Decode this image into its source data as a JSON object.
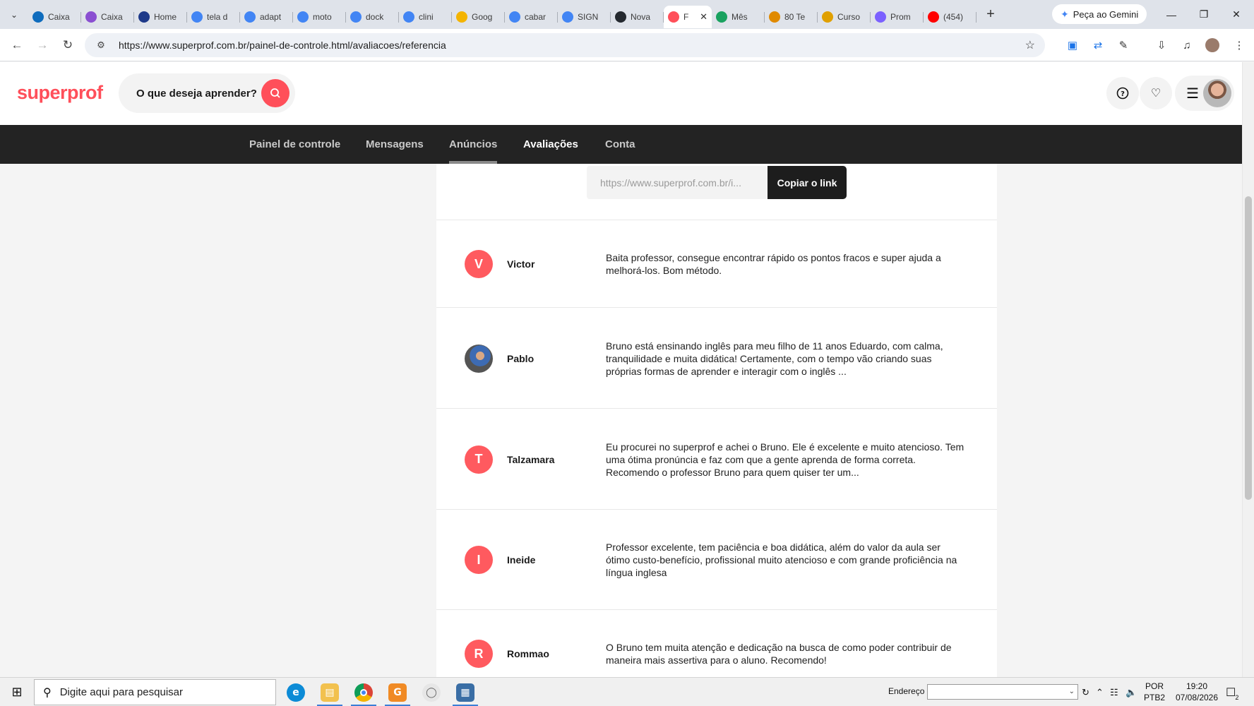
{
  "browser": {
    "tabs": [
      {
        "title": "Caixa",
        "icon": "outlook-icon",
        "color": "#0f6cbd"
      },
      {
        "title": "Caixa",
        "icon": "mail-icon",
        "color": "#8a4fd1"
      },
      {
        "title": "Home",
        "icon": "wordpress-icon",
        "color": "#1e3a8a"
      },
      {
        "title": "tela d",
        "icon": "google-icon",
        "color": "#4285f4"
      },
      {
        "title": "adapt",
        "icon": "google-icon",
        "color": "#4285f4"
      },
      {
        "title": "moto",
        "icon": "google-icon",
        "color": "#4285f4"
      },
      {
        "title": "dock",
        "icon": "google-icon",
        "color": "#4285f4"
      },
      {
        "title": "clini",
        "icon": "google-icon",
        "color": "#4285f4"
      },
      {
        "title": "Goog",
        "icon": "drive-folder-icon",
        "color": "#f4b400"
      },
      {
        "title": "cabar",
        "icon": "google-icon",
        "color": "#4285f4"
      },
      {
        "title": "SIGN",
        "icon": "google-icon",
        "color": "#4285f4"
      },
      {
        "title": "Nova",
        "icon": "github-icon",
        "color": "#24292f"
      },
      {
        "title": "F",
        "icon": "superprof-icon",
        "color": "#ff4f5a",
        "active": true
      },
      {
        "title": "Mês",
        "icon": "k-icon",
        "color": "#1aa260"
      },
      {
        "title": "80 Te",
        "icon": "brain-icon",
        "color": "#e08a00"
      },
      {
        "title": "Curso",
        "icon": "brain-icon",
        "color": "#e0a000"
      },
      {
        "title": "Prom",
        "icon": "purple-app-icon",
        "color": "#7b61ff"
      },
      {
        "title": "(454)",
        "icon": "youtube-icon",
        "color": "#ff0000"
      }
    ],
    "gemini_label": "Peça ao Gemini",
    "url": "https://www.superprof.com.br/painel-de-controle.html/avaliacoes/referencia"
  },
  "site": {
    "logo": "superprof",
    "search_placeholder": "O que deseja aprender?",
    "nav": [
      {
        "label": "Painel de controle",
        "bold": false
      },
      {
        "label": "Mensagens",
        "bold": false
      },
      {
        "label": "Anúncios",
        "bold": false,
        "underlined": true
      },
      {
        "label": "Avaliações",
        "bold": true
      },
      {
        "label": "Conta",
        "bold": false
      }
    ],
    "share_link": "https://www.superprof.com.br/i...",
    "copy_button": "Copiar o link",
    "accent_color": "#ff4f5a"
  },
  "reviews": [
    {
      "initial": "V",
      "name": "Victor",
      "text": "Baita professor, consegue encontrar rápido os pontos fracos e super ajuda a melhorá-los. Bom método."
    },
    {
      "initial": "",
      "name": "Pablo",
      "text": "Bruno está ensinando inglês para meu filho de 11 anos Eduardo, com calma, tranquilidade e muita didática! Certamente, com o tempo vão criando suas próprias formas de aprender e interagir com o inglês ...",
      "photo": true
    },
    {
      "initial": "T",
      "name": "Talzamara",
      "text": "Eu procurei no superprof e achei o Bruno. Ele é excelente e muito atencioso. Tem uma ótima pronúncia e faz com que a gente aprenda de forma correta. Recomendo o professor Bruno para quem quiser ter um..."
    },
    {
      "initial": "I",
      "name": "Ineide",
      "text": "Professor excelente, tem paciência e boa didática, além do valor da aula ser ótimo custo-benefício, profissional muito atencioso e com grande proficiência na língua inglesa"
    },
    {
      "initial": "R",
      "name": "Rommao",
      "text": "O Bruno tem muita atenção e dedicação na busca de como poder contribuir de maneira mais assertiva para o aluno. Recomendo!"
    }
  ],
  "taskbar": {
    "search_placeholder": "Digite aqui para pesquisar",
    "address_label": "Endereço",
    "lang_top": "POR",
    "lang_bottom": "PTB2",
    "time": "19:20",
    "date": "07/08/2026",
    "notification_count": "2"
  }
}
